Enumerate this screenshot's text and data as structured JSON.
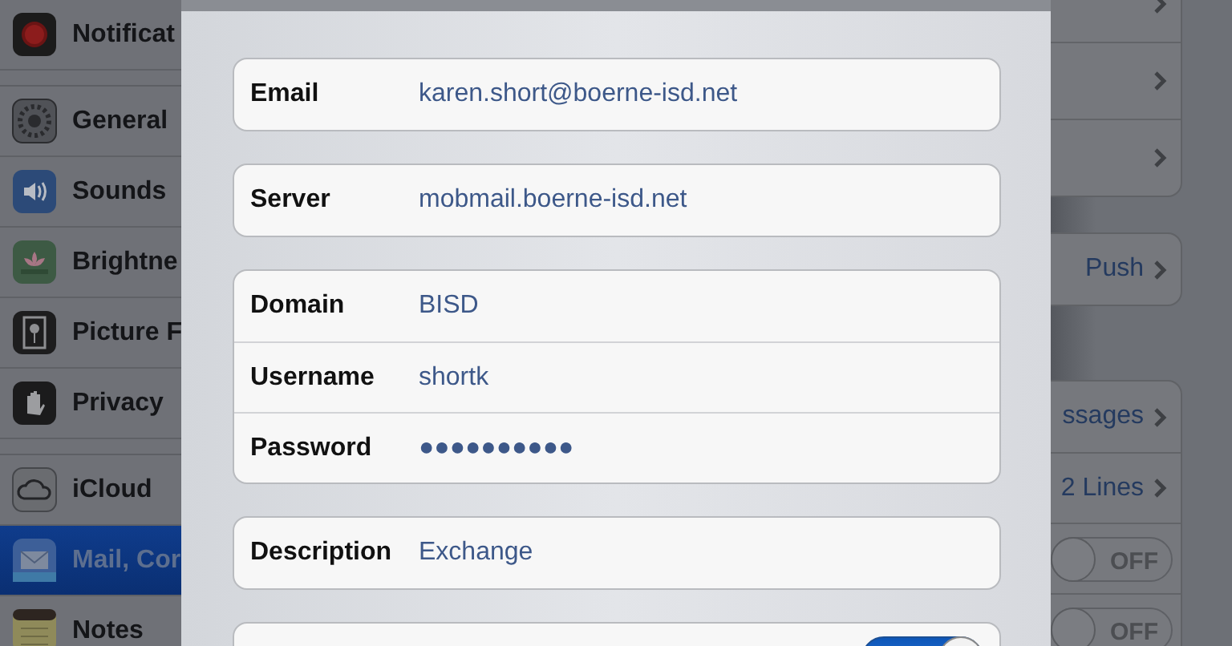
{
  "sidebar": {
    "groups": [
      {
        "items": [
          {
            "label": "Notificat",
            "selected": false
          }
        ]
      },
      {
        "items": [
          {
            "label": "General",
            "selected": false
          },
          {
            "label": "Sounds",
            "selected": false
          },
          {
            "label": "Brightne",
            "selected": false
          },
          {
            "label": "Picture F",
            "selected": false
          },
          {
            "label": "Privacy",
            "selected": false
          }
        ]
      },
      {
        "items": [
          {
            "label": "iCloud",
            "selected": false
          },
          {
            "label": "Mail, Cor",
            "selected": true
          },
          {
            "label": "Notes",
            "selected": false
          }
        ]
      }
    ]
  },
  "account_sheet": {
    "groups": [
      {
        "fields": [
          {
            "kind": "text",
            "label": "Email",
            "value": "karen.short@boerne-isd.net"
          }
        ]
      },
      {
        "fields": [
          {
            "kind": "text",
            "label": "Server",
            "value": "mobmail.boerne-isd.net"
          }
        ]
      },
      {
        "fields": [
          {
            "kind": "text",
            "label": "Domain",
            "value": "BISD"
          },
          {
            "kind": "text",
            "label": "Username",
            "value": "shortk"
          },
          {
            "kind": "text",
            "label": "Password",
            "value": "●●●●●●●●●●"
          }
        ]
      },
      {
        "fields": [
          {
            "kind": "text",
            "label": "Description",
            "value": "Exchange"
          }
        ]
      },
      {
        "fields": [
          {
            "kind": "toggle",
            "on": true
          }
        ]
      }
    ]
  },
  "settings_panel": {
    "groups": [
      {
        "rows": [
          {
            "kind": "chevron"
          },
          {
            "kind": "chevron"
          },
          {
            "kind": "chevron"
          }
        ]
      },
      {
        "rows": [
          {
            "kind": "chevron",
            "value": "Push"
          }
        ]
      },
      {
        "rows": [
          {
            "kind": "chevron",
            "value": "ssages"
          },
          {
            "kind": "chevron",
            "value": "2 Lines"
          },
          {
            "kind": "toggle",
            "on": false,
            "value": "OFF"
          },
          {
            "kind": "toggle",
            "on": false,
            "value": "OFF"
          }
        ]
      }
    ]
  }
}
